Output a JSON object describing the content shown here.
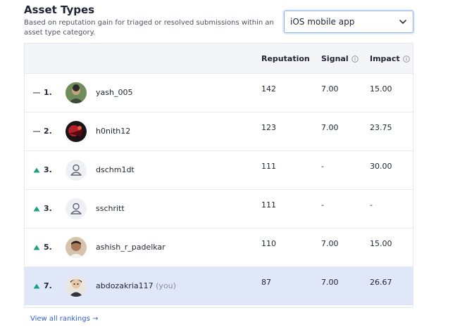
{
  "header": {
    "title": "Asset Types",
    "subtitle": "Based on reputation gain for triaged or resolved submissions within an asset type category."
  },
  "asset_select": {
    "value": "iOS mobile app"
  },
  "table": {
    "columns": {
      "reputation": "Reputation",
      "signal": "Signal",
      "impact": "Impact"
    },
    "rows": [
      {
        "rank": "1.",
        "trend": "same",
        "username": "yash_005",
        "you": "",
        "reputation": "142",
        "signal": "7.00",
        "impact": "15.00",
        "avatar": "photo-avatar"
      },
      {
        "rank": "2.",
        "trend": "same",
        "username": "h0nith12",
        "you": "",
        "reputation": "123",
        "signal": "7.00",
        "impact": "23.75",
        "avatar": "photo-avatar"
      },
      {
        "rank": "3.",
        "trend": "up",
        "username": "dschm1dt",
        "you": "",
        "reputation": "111",
        "signal": "-",
        "impact": "30.00",
        "avatar": "default-user-icon"
      },
      {
        "rank": "3.",
        "trend": "up",
        "username": "sschritt",
        "you": "",
        "reputation": "111",
        "signal": "-",
        "impact": "-",
        "avatar": "default-user-icon"
      },
      {
        "rank": "5.",
        "trend": "up",
        "username": "ashish_r_padelkar",
        "you": "",
        "reputation": "110",
        "signal": "7.00",
        "impact": "15.00",
        "avatar": "photo-avatar"
      },
      {
        "rank": "7.",
        "trend": "up",
        "username": "abdozakria117",
        "you": "(you)",
        "reputation": "87",
        "signal": "7.00",
        "impact": "26.67",
        "avatar": "photo-avatar"
      }
    ]
  },
  "footer": {
    "view_all": "View all rankings →"
  },
  "colors": {
    "trend_up": "#1aa37a",
    "link": "#2f5fd0",
    "highlight_row": "#dfe7f9"
  }
}
